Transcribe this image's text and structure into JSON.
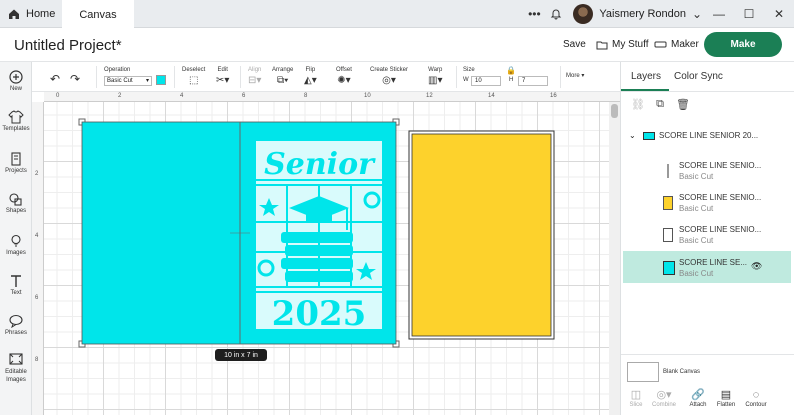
{
  "tabs": {
    "home": "Home",
    "canvas": "Canvas"
  },
  "user": {
    "name": "Yaismery Rondon"
  },
  "header": {
    "title": "Untitled Project*",
    "save": "Save",
    "my_stuff": "My Stuff",
    "maker": "Maker",
    "make": "Make"
  },
  "sidebar": [
    {
      "label": "New",
      "icon": "plus-circle-icon"
    },
    {
      "label": "Templates",
      "icon": "shirt-icon"
    },
    {
      "label": "Projects",
      "icon": "projects-icon"
    },
    {
      "label": "Shapes",
      "icon": "shapes-icon"
    },
    {
      "label": "Images",
      "icon": "lightbulb-icon"
    },
    {
      "label": "Text",
      "icon": "text-icon"
    },
    {
      "label": "Phrases",
      "icon": "chat-icon"
    },
    {
      "label": "Editable Images",
      "icon": "editable-images-icon"
    }
  ],
  "toolbar": {
    "operation_label": "Operation",
    "operation_value": "Basic Cut",
    "operation_color": "#00e5ea",
    "deselect": "Deselect",
    "edit": "Edit",
    "align": "Align",
    "arrange": "Arrange",
    "flip": "Flip",
    "offset": "Offset",
    "create_sticker": "Create Sticker",
    "warp": "Warp",
    "size": "Size",
    "w_label": "W",
    "w_value": "10",
    "h_label": "H",
    "h_value": "7",
    "more": "More"
  },
  "ruler": {
    "top": [
      "0",
      "2",
      "4",
      "6",
      "8",
      "10",
      "12",
      "14",
      "16"
    ],
    "left": [
      "2",
      "4",
      "6",
      "8"
    ]
  },
  "canvas": {
    "size_badge": "10 in x 7 in",
    "card_text_top": "Senior",
    "card_text_bottom": "2025",
    "colors": {
      "cyan": "#00e5ea",
      "yellow": "#fdd22c"
    }
  },
  "right_panel": {
    "tab_layers": "Layers",
    "tab_color_sync": "Color Sync",
    "group_name": "SCORE LINE SENIOR 20...",
    "layers": [
      {
        "name": "SCORE LINE SENIO...",
        "sub": "Basic Cut",
        "swatch": "line"
      },
      {
        "name": "SCORE LINE SENIO...",
        "sub": "Basic Cut",
        "swatch": "#fdd22c"
      },
      {
        "name": "SCORE LINE SENIO...",
        "sub": "Basic Cut",
        "swatch": "#ffffff"
      },
      {
        "name": "SCORE LINE SE...",
        "sub": "Basic Cut",
        "swatch": "#00e5ea"
      }
    ],
    "blank_canvas": "Blank Canvas",
    "bottom_tools": [
      "Slice",
      "Combine",
      "Attach",
      "Flatten",
      "Contour"
    ]
  }
}
